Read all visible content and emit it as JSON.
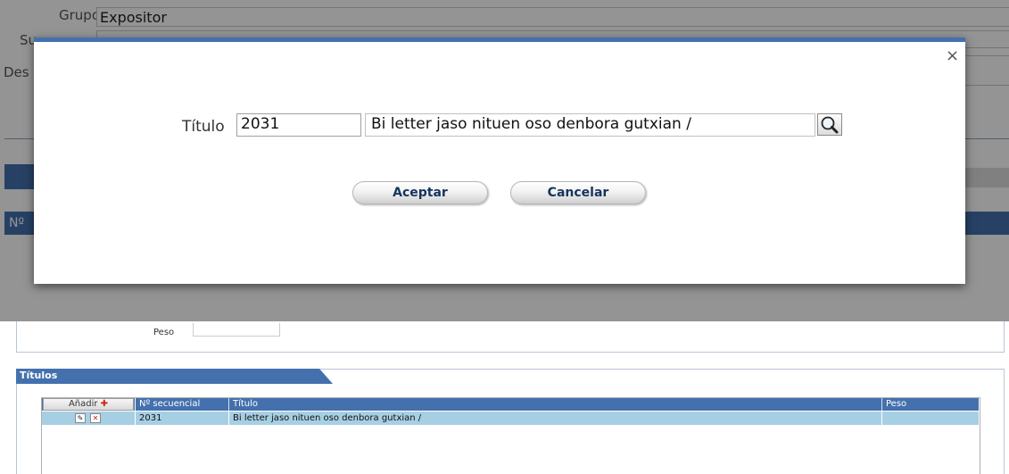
{
  "background": {
    "grupo_label": "Grupo",
    "grupo_value": "Expositor",
    "sub_label_partial": "Su",
    "desc_label_partial": "Des",
    "num_label_partial": "Nº"
  },
  "peso_section": {
    "peso_label": "Peso",
    "peso_value": ""
  },
  "titulos": {
    "tab_label": "Títulos",
    "add_button": "Añadir",
    "add_icon": "plus-icon",
    "columns": [
      "Nº secuencial",
      "Título",
      "Peso"
    ],
    "rows": [
      {
        "secuencial": "2031",
        "titulo": "Bi letter jaso nituen oso denbora gutxian /",
        "peso": ""
      }
    ]
  },
  "modal": {
    "label": "Título",
    "code_value": "2031",
    "title_value": "Bi letter jaso nituen oso denbora gutxian /",
    "search_icon": "magnifier-icon",
    "close_icon": "×",
    "accept_label": "Aceptar",
    "cancel_label": "Cancelar"
  },
  "colors": {
    "accent": "#4471ae",
    "selected_row": "#a7cfe4",
    "add_plus": "#d0271d"
  }
}
